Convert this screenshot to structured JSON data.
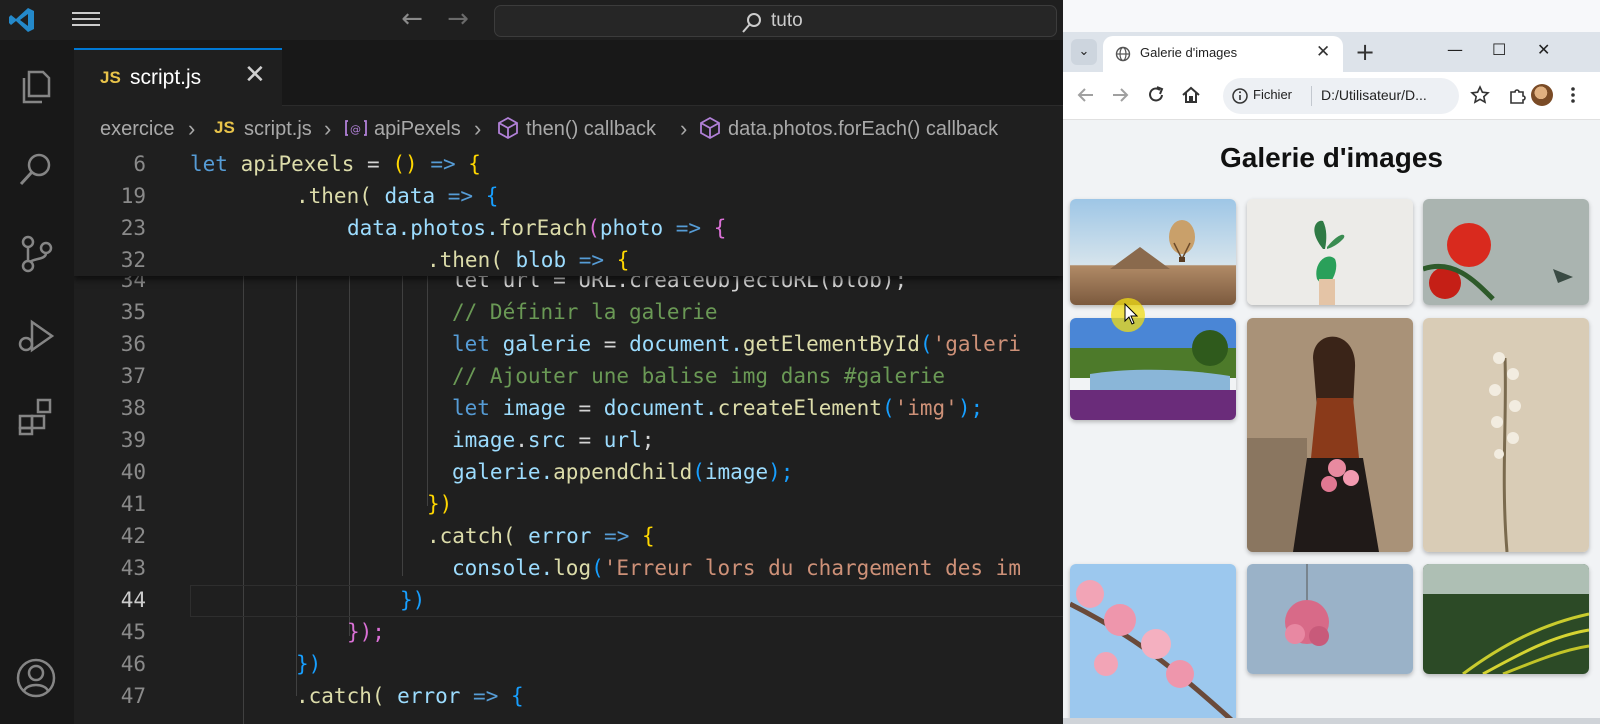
{
  "vscode": {
    "search_text": "tuto",
    "tab": {
      "badge": "JS",
      "label": "script.js",
      "close": "✕"
    },
    "breadcrumb": {
      "folder": "exercice",
      "file_badge": "JS",
      "file": "script.js",
      "symbol1": "apiPexels",
      "symbol2": "then() callback",
      "symbol3": "data.photos.forEach() callback"
    },
    "sticky_lines": [
      {
        "n": "6"
      },
      {
        "n": "19"
      },
      {
        "n": "23"
      },
      {
        "n": "32"
      }
    ],
    "lines": [
      {
        "n": "34"
      },
      {
        "n": "35"
      },
      {
        "n": "36"
      },
      {
        "n": "37"
      },
      {
        "n": "38"
      },
      {
        "n": "39"
      },
      {
        "n": "40"
      },
      {
        "n": "41"
      },
      {
        "n": "42"
      },
      {
        "n": "43"
      },
      {
        "n": "44"
      },
      {
        "n": "45"
      },
      {
        "n": "46"
      },
      {
        "n": "47"
      }
    ],
    "code": {
      "l6": [
        "let",
        "apiPexels",
        "=",
        "()",
        "=>",
        "{"
      ],
      "l19": [
        ".then(",
        "data",
        "=>",
        "{"
      ],
      "l23": [
        "data.photos.",
        "forEach",
        "(",
        "photo",
        "=>",
        "{"
      ],
      "l32": [
        ".then(",
        "blob",
        "=>",
        "{"
      ],
      "l34": "let url = URL.createObjectURL(blob);",
      "l35": "// Définir la galerie",
      "l36": [
        "let",
        "galerie",
        "=",
        "document.",
        "getElementById",
        "(",
        "'galeri"
      ],
      "l37": "// Ajouter une balise img dans #galerie",
      "l38": [
        "let",
        "image",
        "=",
        "document.",
        "createElement",
        "(",
        "'img'",
        ");"
      ],
      "l39": [
        "image",
        ".",
        "src",
        "=",
        "url",
        ";"
      ],
      "l40": [
        "galerie.",
        "appendChild",
        "(",
        "image",
        ");"
      ],
      "l41": [
        "})"
      ],
      "l42": [
        ".catch(",
        "error",
        "=>",
        "{"
      ],
      "l43": [
        "console.",
        "log",
        "(",
        "'Erreur lors du chargement des im"
      ],
      "l44": [
        "})"
      ],
      "l45": [
        "});"
      ],
      "l46": [
        "})"
      ],
      "l47": [
        ".catch(",
        "error",
        "=>",
        "{"
      ]
    }
  },
  "chrome": {
    "tab_title": "Galerie d'images",
    "tab_close": "✕",
    "new_tab": "+",
    "scheme_label": "Fichier",
    "url": "D:/Utilisateur/D...",
    "page_title": "Galerie d'images"
  },
  "photos": [
    {
      "name": "balloon-desert"
    },
    {
      "name": "plant-hand"
    },
    {
      "name": "red-flower-hummingbird"
    },
    {
      "name": "lake-park"
    },
    {
      "name": "woman-flowers"
    },
    {
      "name": "dried-flowers"
    },
    {
      "name": "cherry-blossom"
    },
    {
      "name": "hanging-flowers"
    },
    {
      "name": "rice-terraces"
    }
  ],
  "colors": {
    "accent": "#0078d4",
    "editor_bg": "#1f1f1f",
    "js_yellow": "#e8c34a"
  }
}
